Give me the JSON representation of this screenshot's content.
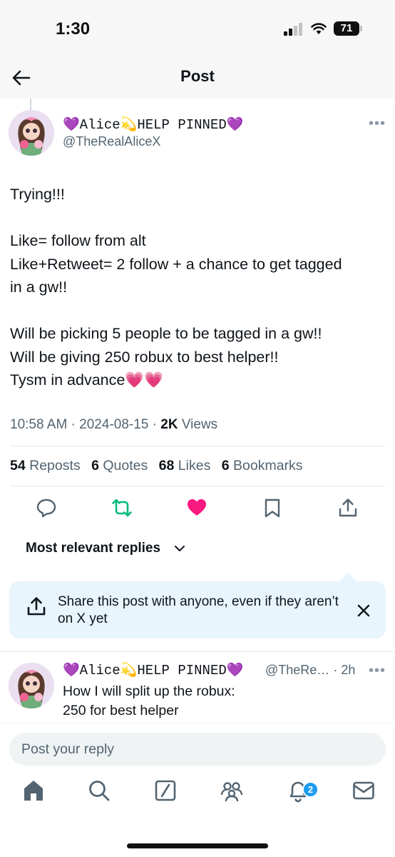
{
  "status_bar": {
    "time": "1:30",
    "battery": "71"
  },
  "header": {
    "title": "Post"
  },
  "post": {
    "author_name": "💜Alice💫HELP PINNED💜",
    "author_handle": "@TheRealAliceX",
    "body_lines": [
      "Trying!!!",
      "",
      "Like= follow from alt",
      "Like+Retweet= 2 follow + a chance to get tagged",
      "in a gw!!",
      "",
      "Will be picking 5 people to be tagged in a gw!!",
      "Will be giving 250 robux to best helper!!",
      "Tysm in advance💗💗"
    ],
    "time": "10:58 AM",
    "date": "2024-08-15",
    "views_count": "2K",
    "views_label": "Views",
    "stats": [
      {
        "count": "54",
        "label": "Reposts"
      },
      {
        "count": "6",
        "label": "Quotes"
      },
      {
        "count": "68",
        "label": "Likes"
      },
      {
        "count": "6",
        "label": "Bookmarks"
      }
    ],
    "actions": [
      "reply-icon",
      "repost-icon",
      "like-icon",
      "bookmark-icon",
      "share-icon"
    ],
    "liked": true,
    "reposted": true
  },
  "replies": {
    "sort_label": "Most relevant replies",
    "share_card_text": "Share this post with anyone, even if they aren’t on X yet",
    "first_reply": {
      "author_name": "💜Alice💫HELP PINNED💜",
      "handle_truncated": "@TheRe…",
      "time": "2h",
      "lines": [
        "How I will split up the robux:",
        "250 for best helper"
      ]
    }
  },
  "reply_box": {
    "placeholder": "Post your reply"
  },
  "tab_bar": {
    "items": [
      "home-icon",
      "search-icon",
      "grok-icon",
      "communities-icon",
      "notifications-icon",
      "messages-icon"
    ],
    "notification_badge": "2"
  },
  "colors": {
    "accent": "#1d9bf0",
    "like": "#f91880",
    "repost": "#00ba7c",
    "share_card_bg": "#e8f5fd"
  }
}
